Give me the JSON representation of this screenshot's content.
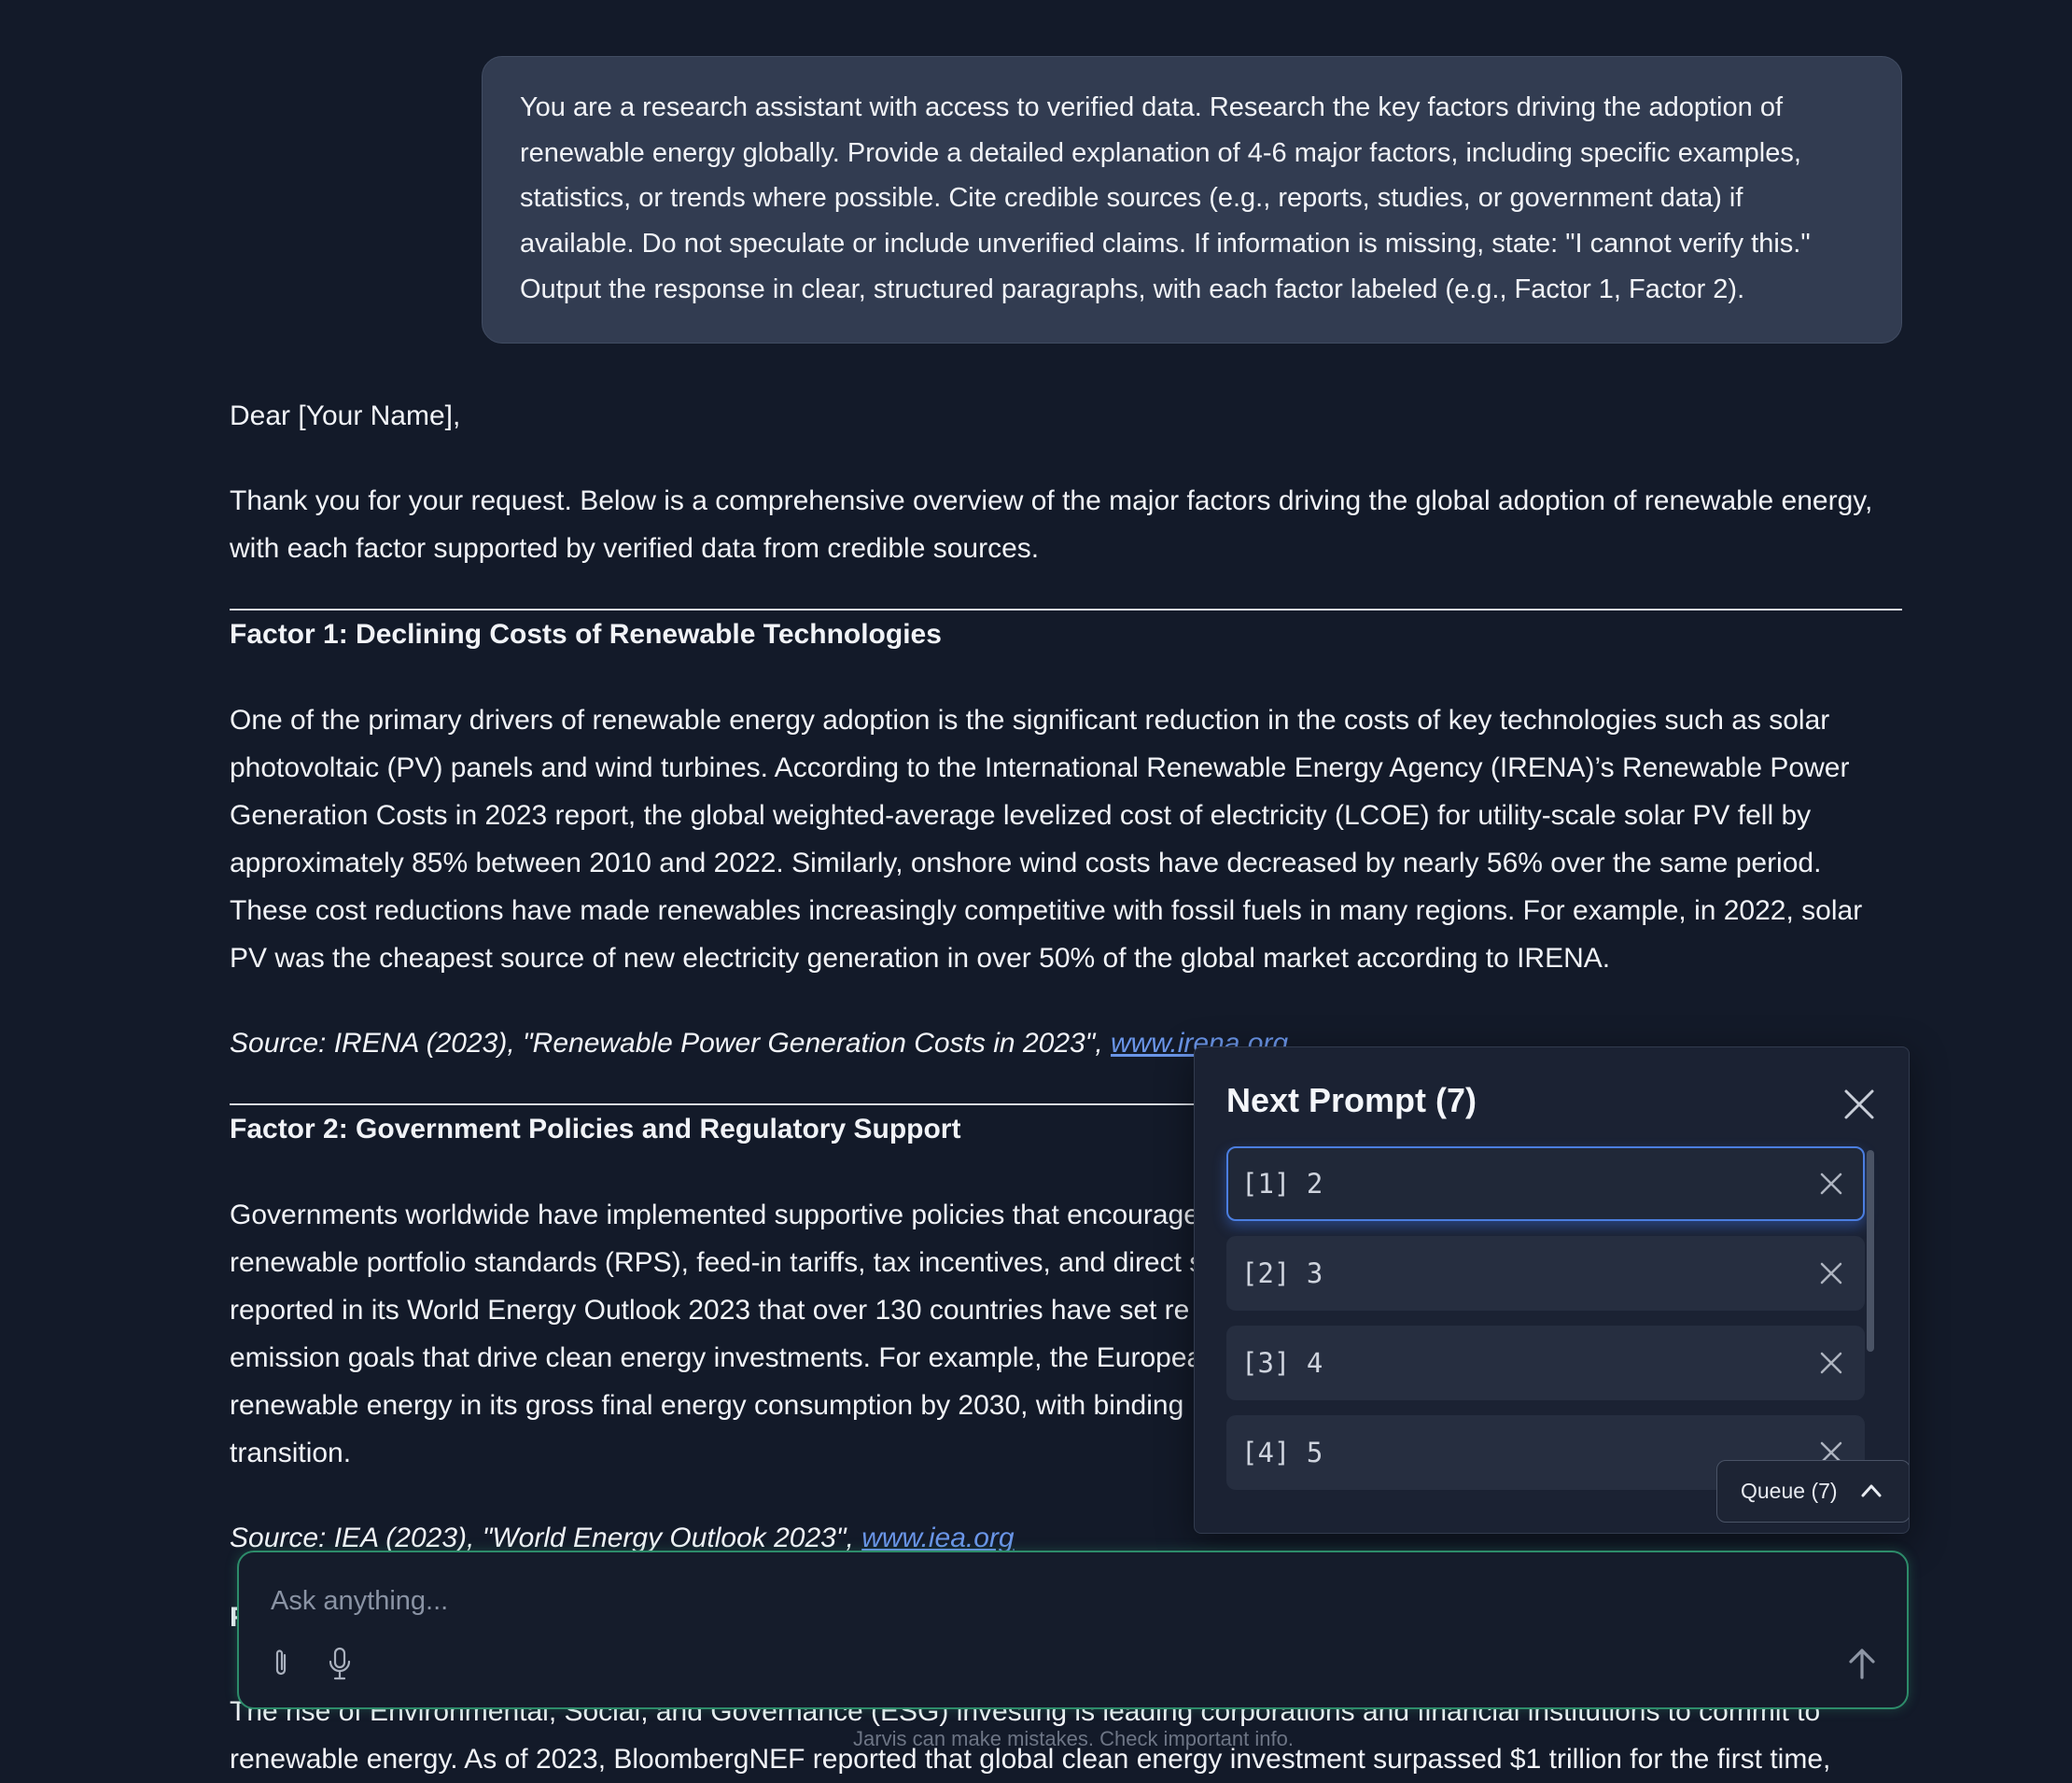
{
  "user_message": "You are a research assistant with access to verified data. Research the key factors driving the adoption of renewable energy globally. Provide a detailed explanation of 4-6 major factors, including specific examples, statistics, or trends where possible. Cite credible sources (e.g., reports, studies, or government data) if available. Do not speculate or include unverified claims. If information is missing, state: \"I cannot verify this.\" Output the response in clear, structured paragraphs, with each factor labeled (e.g., Factor 1, Factor 2).",
  "response": {
    "greeting": "Dear [Your Name],",
    "intro": "Thank you for your request. Below is a comprehensive overview of the major factors driving the global adoption of renewable energy, with each factor supported by verified data from credible sources.",
    "factor1": {
      "title": "Factor 1: Declining Costs of Renewable Technologies",
      "body": "One of the primary drivers of renewable energy adoption is the significant reduction in the costs of key technologies such as solar photovoltaic (PV) panels and wind turbines. According to the International Renewable Energy Agency (IRENA)’s Renewable Power Generation Costs in 2023 report, the global weighted-average levelized cost of electricity (LCOE) for utility-scale solar PV fell by approximately 85% between 2010 and 2022. Similarly, onshore wind costs have decreased by nearly 56% over the same period. These cost reductions have made renewables increasingly competitive with fossil fuels in many regions. For example, in 2022, solar PV was the cheapest source of new electricity generation in over 50% of the global market according to IRENA.",
      "source_text": "Source: IRENA (2023), \"Renewable Power Generation Costs in 2023\", ",
      "source_link": "www.irena.org"
    },
    "factor2": {
      "title": "Factor 2: Government Policies and Regulatory Support",
      "lines": [
        "Governments worldwide have implemented supportive policies that encourage",
        "renewable portfolio standards (RPS), feed-in tariffs, tax incentives, and direct s",
        "reported in its World Energy Outlook 2023 that over 130 countries have set re",
        "emission goals that drive clean energy investments. For example, the Europea",
        "renewable energy in its gross final energy consumption by 2030, with binding",
        "transition."
      ],
      "source_text": "Source: IEA (2023), \"World Energy Outlook 2023\", ",
      "source_link": "www.iea.org"
    },
    "factor3": {
      "title_partial": "F",
      "body_lines": [
        "The rise of Environmental, Social, and Governance (ESG) investing is leading corporations and financial institutions to commit to",
        "renewable energy. As of 2023, BloombergNEF reported that global clean energy investment surpassed $1 trillion for the first time,"
      ]
    }
  },
  "next_prompt_panel": {
    "title": "Next Prompt (7)",
    "items": [
      {
        "label": "[1] 2"
      },
      {
        "label": "[2] 3"
      },
      {
        "label": "[3] 4"
      },
      {
        "label": "[4] 5"
      }
    ],
    "queue_label": "Queue (7)"
  },
  "composer": {
    "placeholder": "Ask anything..."
  },
  "disclaimer": "Jarvis can make mistakes. Check important info.",
  "colors": {
    "background": "#131a29",
    "accent_link": "#6a95e8",
    "input_border": "#2d8c6a",
    "active_item_border": "#4b7ee0"
  },
  "icons": [
    "close-icon",
    "attach-icon",
    "microphone-icon",
    "send-arrow-icon",
    "chevron-up-icon"
  ]
}
